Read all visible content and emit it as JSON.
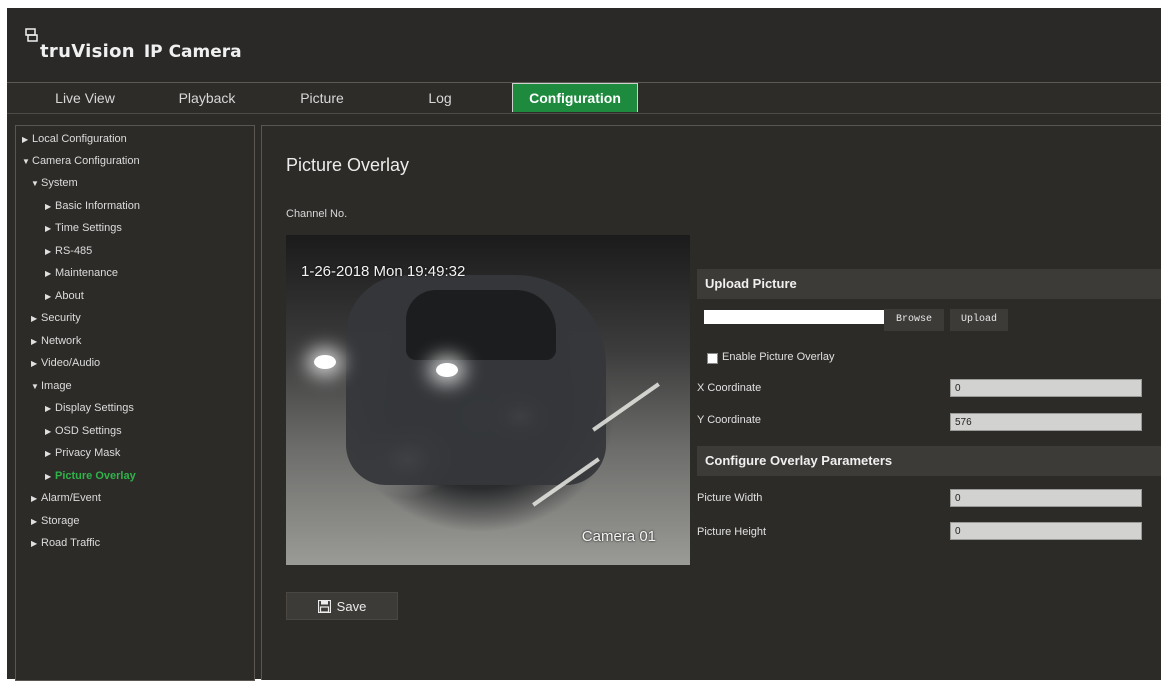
{
  "header": {
    "brand": "truVision",
    "product": "IP Camera",
    "logo_icon": "truvision-logo-icon"
  },
  "nav": {
    "tabs": [
      {
        "label": "Live View"
      },
      {
        "label": "Playback"
      },
      {
        "label": "Picture"
      },
      {
        "label": "Log"
      },
      {
        "label": "Configuration"
      }
    ],
    "active": "Configuration",
    "active_color": "#1d8a3e"
  },
  "sidebar": {
    "items": [
      {
        "label": "Local Configuration",
        "expanded": false
      },
      {
        "label": "Camera Configuration",
        "expanded": true
      },
      {
        "label": "System",
        "expanded": true
      },
      {
        "label": "Basic Information"
      },
      {
        "label": "Time Settings"
      },
      {
        "label": "RS-485"
      },
      {
        "label": "Maintenance"
      },
      {
        "label": "About"
      },
      {
        "label": "Security"
      },
      {
        "label": "Network"
      },
      {
        "label": "Video/Audio"
      },
      {
        "label": "Image",
        "expanded": true
      },
      {
        "label": "Display Settings"
      },
      {
        "label": "OSD Settings"
      },
      {
        "label": "Privacy Mask"
      },
      {
        "label": "Picture Overlay",
        "selected": true
      },
      {
        "label": "Alarm/Event"
      },
      {
        "label": "Storage"
      },
      {
        "label": "Road Traffic"
      }
    ],
    "selected_color": "#2fb34a"
  },
  "main": {
    "title": "Picture Overlay",
    "channel_label": "Channel No.",
    "video": {
      "osd_date": "1-26-2018  Mon  19:49:32",
      "osd_camera": "Camera 01"
    },
    "save_label": "Save",
    "upload_section": {
      "title": "Upload Picture",
      "file_value": "",
      "browse_label": "Browse",
      "upload_label": "Upload",
      "enable_label": "Enable Picture Overlay",
      "enable_checked": false,
      "x_label": "X Coordinate",
      "x_value": "0",
      "y_label": "Y Coordinate",
      "y_value": "576"
    },
    "overlay_section": {
      "title": "Configure Overlay Parameters",
      "width_label": "Picture Width",
      "width_value": "0",
      "height_label": "Picture Height",
      "height_value": "0"
    }
  }
}
